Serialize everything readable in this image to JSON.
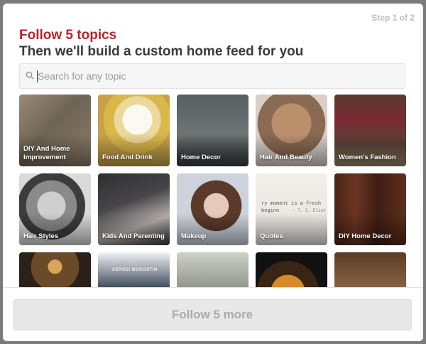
{
  "step": "Step 1 of 2",
  "title": "Follow 5 topics",
  "subtitle": "Then we'll build a custom home feed for you",
  "search": {
    "placeholder": "Search for any topic",
    "value": ""
  },
  "topics": [
    {
      "label": "DIY And Home Improvement"
    },
    {
      "label": "Food And Drink"
    },
    {
      "label": "Home Decor"
    },
    {
      "label": "Hair And Beauty"
    },
    {
      "label": "Women's Fashion"
    },
    {
      "label": "Hair Styles"
    },
    {
      "label": "Kids And Parenting"
    },
    {
      "label": "Makeup"
    },
    {
      "label": "Quotes",
      "quote_text": "ry moment is a fresh beginn",
      "quote_author": "- T. S. Eliot"
    },
    {
      "label": "DIY Home Decor"
    },
    {
      "label": ""
    },
    {
      "label": "",
      "image_text": "SERGEI BOGOSTIN"
    },
    {
      "label": ""
    },
    {
      "label": ""
    },
    {
      "label": ""
    }
  ],
  "footer": {
    "button_label": "Follow 5 more"
  },
  "colors": {
    "title": "#b5242b",
    "subtitle": "#3a3a3a",
    "button_bg": "#e8e8e8",
    "button_text": "#ababab"
  }
}
